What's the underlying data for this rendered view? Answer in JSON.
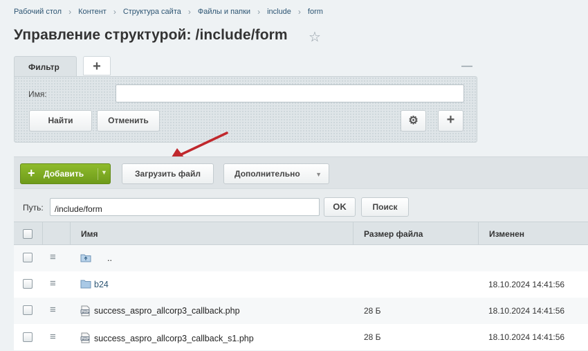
{
  "breadcrumb": [
    "Рабочий стол",
    "Контент",
    "Структура сайта",
    "Файлы и папки",
    "include",
    "form"
  ],
  "page_title": "Управление структурой: /include/form",
  "filter": {
    "tab_label": "Фильтр",
    "name_label": "Имя:",
    "name_value": "",
    "find_label": "Найти",
    "cancel_label": "Отменить"
  },
  "toolbar": {
    "add_label": "Добавить",
    "upload_label": "Загрузить файл",
    "more_label": "Дополнительно"
  },
  "path": {
    "label": "Путь:",
    "value": "/include/form",
    "ok_label": "OK",
    "search_label": "Поиск"
  },
  "table": {
    "headers": {
      "name": "Имя",
      "size": "Размер файла",
      "modified": "Изменен"
    },
    "rows": [
      {
        "icon": "folder-up-icon",
        "name": "..",
        "size": "",
        "modified": ""
      },
      {
        "icon": "folder-icon",
        "name": "b24",
        "size": "",
        "modified": "18.10.2024 14:41:56"
      },
      {
        "icon": "php-file-icon",
        "name": "success_aspro_allcorp3_callback.php",
        "size": "28 Б",
        "modified": "18.10.2024 14:41:56"
      },
      {
        "icon": "php-file-icon",
        "name": "success_aspro_allcorp3_callback_s1.php",
        "size": "28 Б",
        "modified": "18.10.2024 14:41:56"
      }
    ]
  },
  "colors": {
    "accent_green": "#7aa622",
    "link": "#2d5573",
    "annotation_arrow": "#c0282d"
  }
}
